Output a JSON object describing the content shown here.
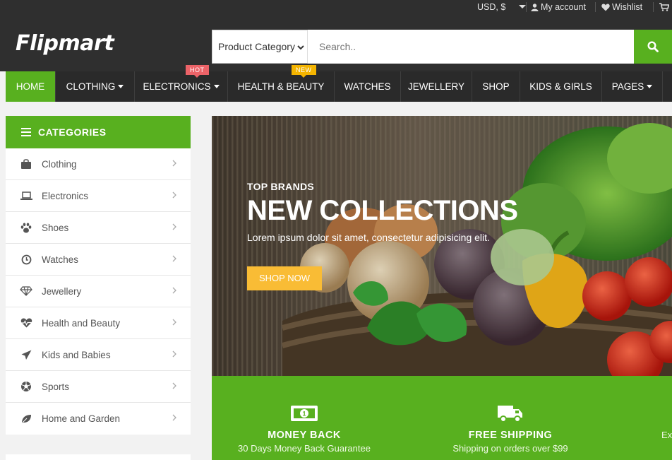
{
  "topbar": {
    "currency": "USD, $",
    "account": "My account",
    "wishlist": "Wishlist"
  },
  "logo": "Flipmart",
  "search": {
    "category": "Product Category",
    "placeholder": "Search.."
  },
  "nav": {
    "items": [
      {
        "label": "Home",
        "dropdown": false,
        "active": true
      },
      {
        "label": "Clothing",
        "dropdown": true
      },
      {
        "label": "Electronics",
        "dropdown": true,
        "badge": "HOT"
      },
      {
        "label": "Health & Beauty",
        "dropdown": false,
        "badge": "NEW"
      },
      {
        "label": "Watches",
        "dropdown": false
      },
      {
        "label": "Jewellery",
        "dropdown": false
      },
      {
        "label": "Shop",
        "dropdown": false
      },
      {
        "label": "Kids & Girls",
        "dropdown": false
      },
      {
        "label": "Pages",
        "dropdown": true
      }
    ],
    "badges": {
      "hot": "HOT",
      "new": "NEW"
    }
  },
  "sidebar": {
    "title": "CATEGORIES",
    "items": [
      {
        "label": "Clothing",
        "icon": "shopping-bag-icon"
      },
      {
        "label": "Electronics",
        "icon": "laptop-icon"
      },
      {
        "label": "Shoes",
        "icon": "paw-icon"
      },
      {
        "label": "Watches",
        "icon": "clock-icon"
      },
      {
        "label": "Jewellery",
        "icon": "diamond-icon"
      },
      {
        "label": "Health and Beauty",
        "icon": "heartbeat-icon"
      },
      {
        "label": "Kids and Babies",
        "icon": "paper-plane-icon"
      },
      {
        "label": "Sports",
        "icon": "soccer-ball-icon"
      },
      {
        "label": "Home and Garden",
        "icon": "leaf-icon"
      }
    ]
  },
  "hero": {
    "subtitle": "TOP BRANDS",
    "title": "NEW COLLECTIONS",
    "description": "Lorem ipsum dolor sit amet, consectetur adipisicing elit.",
    "button": "Shop Now"
  },
  "info": [
    {
      "title": "MONEY BACK",
      "desc": "30 Days Money Back Guarantee",
      "icon": "money-icon"
    },
    {
      "title": "FREE SHIPPING",
      "desc": "Shipping on orders over $99",
      "icon": "truck-icon"
    },
    {
      "title": "",
      "desc": "Ex",
      "icon": ""
    }
  ],
  "colors": {
    "accent": "#58b01f",
    "dark": "#2f2f2f",
    "nav": "#2a2a2a",
    "hot": "#ec6368",
    "new": "#f4b400",
    "button": "#f9bc35"
  }
}
